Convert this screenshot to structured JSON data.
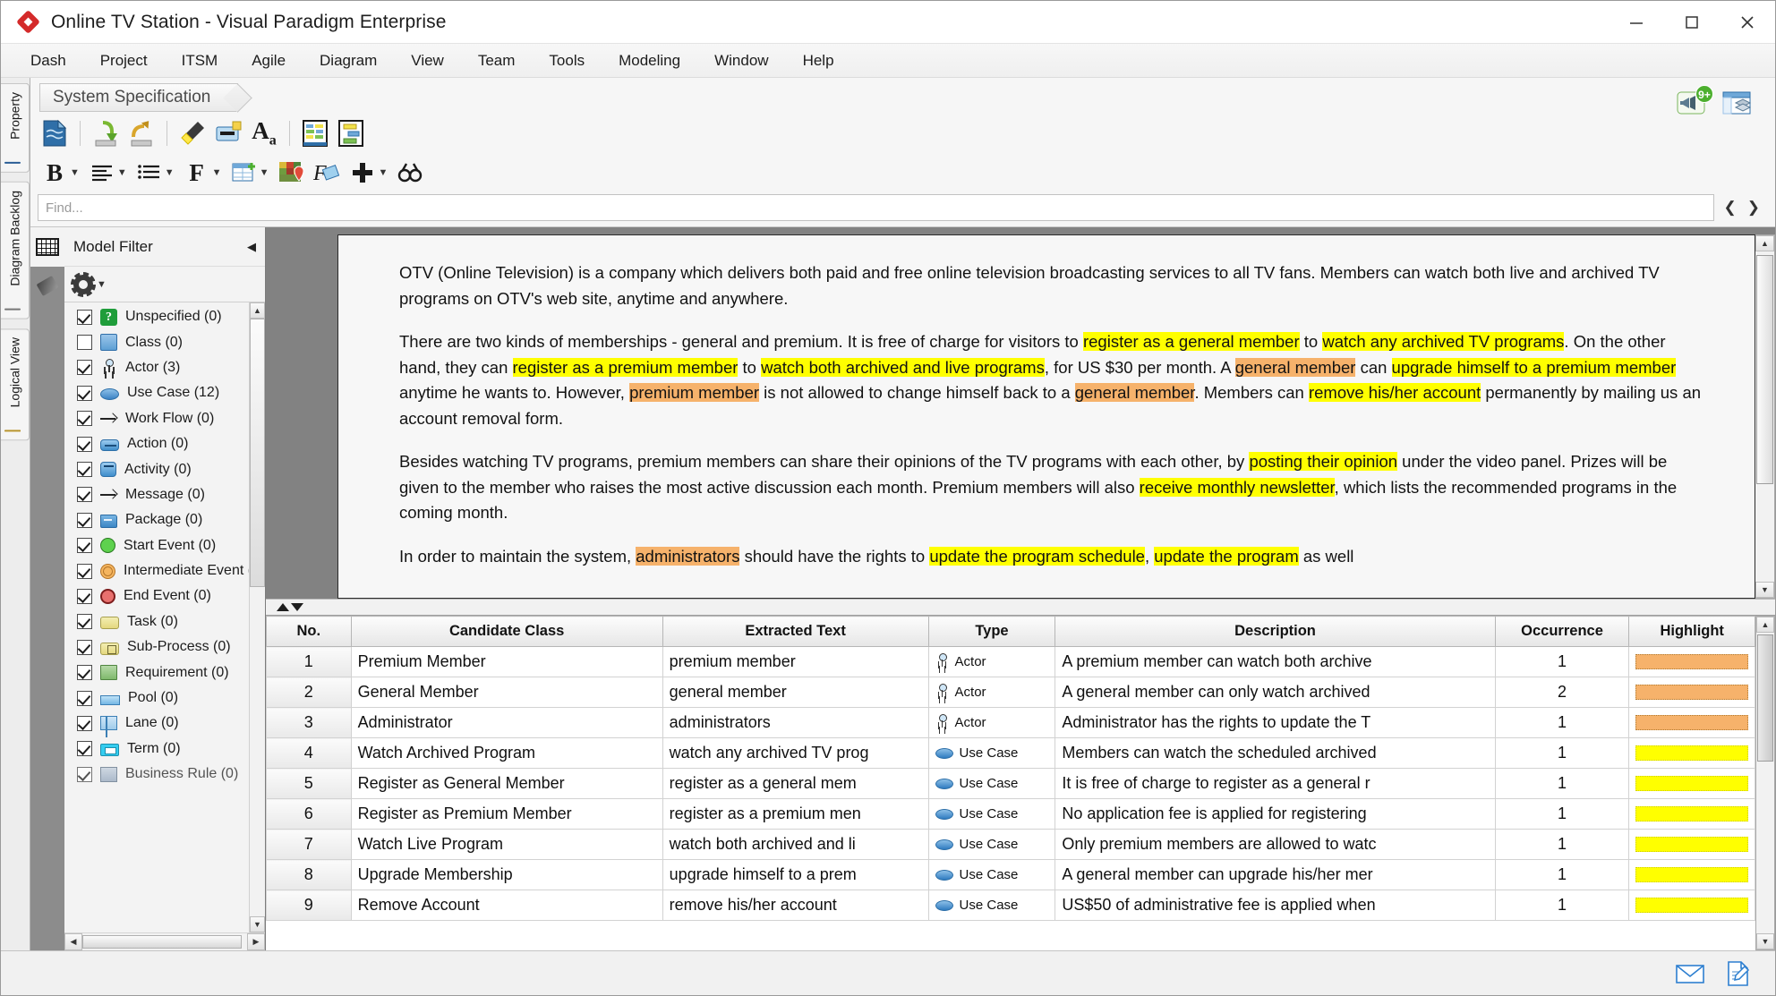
{
  "window": {
    "title": "Online TV Station - Visual Paradigm Enterprise",
    "logo_icon": "visual-paradigm-diamond-logo",
    "minimize_icon": "minimize-icon",
    "maximize_icon": "maximize-icon",
    "close_icon": "close-icon"
  },
  "menubar": {
    "items": [
      {
        "label": "Dash"
      },
      {
        "label": "Project"
      },
      {
        "label": "ITSM"
      },
      {
        "label": "Agile"
      },
      {
        "label": "Diagram"
      },
      {
        "label": "View"
      },
      {
        "label": "Team"
      },
      {
        "label": "Tools"
      },
      {
        "label": "Modeling"
      },
      {
        "label": "Window"
      },
      {
        "label": "Help"
      }
    ]
  },
  "breadcrumb": {
    "label": "System Specification"
  },
  "header_icons": {
    "notification": {
      "icon": "megaphone-icon",
      "badge": "9+"
    },
    "panel": {
      "icon": "open-panel-icon"
    }
  },
  "toolbar_primary": {
    "buttons": [
      {
        "icon": "document-properties-icon",
        "label": "Document Properties"
      },
      {
        "icon": "import-icon",
        "label": "Import"
      },
      {
        "icon": "export-icon",
        "label": "Export"
      },
      {
        "icon": "highlighter-icon",
        "label": "Highlighter"
      },
      {
        "icon": "annotate-icon",
        "label": "Annotate"
      },
      {
        "icon": "font-format-icon",
        "label": "Font"
      },
      {
        "icon": "candidate-class-view-icon",
        "label": "Candidate Classes"
      },
      {
        "icon": "diagram-view-icon",
        "label": "Diagram View"
      }
    ]
  },
  "toolbar_secondary": {
    "buttons": [
      {
        "icon": "bold-icon",
        "label": "B",
        "has_caret": true
      },
      {
        "icon": "align-icon",
        "label": "Align",
        "has_caret": true
      },
      {
        "icon": "list-icon",
        "label": "List",
        "has_caret": true
      },
      {
        "icon": "font-icon",
        "label": "F",
        "has_caret": true
      },
      {
        "icon": "insert-table-icon",
        "label": "Insert Table",
        "has_caret": true
      },
      {
        "icon": "color-picker-icon",
        "label": "Color"
      },
      {
        "icon": "format-shape-icon",
        "label": "Format Shape"
      },
      {
        "icon": "add-icon",
        "label": "Add",
        "has_caret": true
      },
      {
        "icon": "binoculars-find-icon",
        "label": "Find"
      }
    ]
  },
  "find": {
    "placeholder": "Find...",
    "value": "",
    "prev_icon": "chevron-left-icon",
    "next_icon": "chevron-right-icon"
  },
  "vertical_tabs": [
    {
      "label": "Property",
      "icon": "property-panel-icon"
    },
    {
      "label": "Diagram Backlog",
      "icon": "backlog-icon"
    },
    {
      "label": "Logical View",
      "icon": "folder-icon"
    }
  ],
  "model_filter": {
    "title": "Model Filter",
    "collapse_icon": "collapse-left-icon",
    "side_icons": [
      {
        "icon": "grid-table-icon",
        "selected": true
      },
      {
        "icon": "highlighter-pen-icon",
        "selected": false
      }
    ],
    "options_icon": "gear-icon",
    "options_caret": "caret-down-icon",
    "items": [
      {
        "label": "Unspecified (0)",
        "checked": true,
        "icon": "unspecified-icon"
      },
      {
        "label": "Class (0)",
        "checked": false,
        "icon": "class-icon"
      },
      {
        "label": "Actor (3)",
        "checked": true,
        "icon": "actor-icon"
      },
      {
        "label": "Use Case (12)",
        "checked": true,
        "icon": "usecase-icon"
      },
      {
        "label": "Work Flow (0)",
        "checked": true,
        "icon": "workflow-arrow-icon"
      },
      {
        "label": "Action (0)",
        "checked": true,
        "icon": "action-icon"
      },
      {
        "label": "Activity (0)",
        "checked": true,
        "icon": "activity-icon"
      },
      {
        "label": "Message (0)",
        "checked": true,
        "icon": "message-arrow-icon"
      },
      {
        "label": "Package (0)",
        "checked": true,
        "icon": "package-icon"
      },
      {
        "label": "Start Event (0)",
        "checked": true,
        "icon": "start-event-icon"
      },
      {
        "label": "Intermediate Event (0)",
        "checked": true,
        "icon": "intermediate-event-icon"
      },
      {
        "label": "End Event (0)",
        "checked": true,
        "icon": "end-event-icon"
      },
      {
        "label": "Task (0)",
        "checked": true,
        "icon": "task-icon"
      },
      {
        "label": "Sub-Process (0)",
        "checked": true,
        "icon": "subprocess-icon"
      },
      {
        "label": "Requirement (0)",
        "checked": true,
        "icon": "requirement-icon"
      },
      {
        "label": "Pool (0)",
        "checked": true,
        "icon": "pool-icon"
      },
      {
        "label": "Lane (0)",
        "checked": true,
        "icon": "lane-icon"
      },
      {
        "label": "Term (0)",
        "checked": true,
        "icon": "term-icon"
      },
      {
        "label": "Business Rule (0)",
        "checked": true,
        "icon": "business-rule-icon"
      }
    ]
  },
  "document": {
    "paragraphs": [
      [
        {
          "t": "OTV (Online Television) is a company which delivers both paid and free online television broadcasting services to all TV fans. Members can watch both live and archived TV programs on OTV's web site, anytime and anywhere.",
          "h": "none"
        }
      ],
      [
        {
          "t": "There are two kinds of memberships - general and premium. It is free of charge for visitors to ",
          "h": "none"
        },
        {
          "t": "register as a general member",
          "h": "yellow"
        },
        {
          "t": " to ",
          "h": "none"
        },
        {
          "t": "watch any archived TV programs",
          "h": "yellow"
        },
        {
          "t": ". On the other hand, they can ",
          "h": "none"
        },
        {
          "t": "register as a premium member",
          "h": "yellow"
        },
        {
          "t": " to ",
          "h": "none"
        },
        {
          "t": "watch both archived and live programs",
          "h": "yellow"
        },
        {
          "t": ", for US $30 per month. A ",
          "h": "none"
        },
        {
          "t": "general member",
          "h": "orange"
        },
        {
          "t": " can ",
          "h": "none"
        },
        {
          "t": "upgrade himself to a premium member",
          "h": "yellow"
        },
        {
          "t": " anytime he wants to. However, ",
          "h": "none"
        },
        {
          "t": "premium member",
          "h": "orange"
        },
        {
          "t": " is not allowed to change himself back to a ",
          "h": "none"
        },
        {
          "t": "general member",
          "h": "orange"
        },
        {
          "t": ". Members can ",
          "h": "none"
        },
        {
          "t": "remove his/her account",
          "h": "yellow"
        },
        {
          "t": " permanently by mailing us an account removal form.",
          "h": "none"
        }
      ],
      [
        {
          "t": "Besides watching TV programs, premium members can share their opinions of the TV programs with each other, by ",
          "h": "none"
        },
        {
          "t": "posting their opinion",
          "h": "yellow"
        },
        {
          "t": " under the video panel. Prizes will be given to the member who raises the most active discussion each month. Premium members will also ",
          "h": "none"
        },
        {
          "t": "receive monthly newsletter",
          "h": "yellow"
        },
        {
          "t": ", which lists the recommended programs in the coming month.",
          "h": "none"
        }
      ],
      [
        {
          "t": "In order to maintain the system, ",
          "h": "none"
        },
        {
          "t": "administrators",
          "h": "orange"
        },
        {
          "t": " should have the rights to ",
          "h": "none"
        },
        {
          "t": "update the program schedule",
          "h": "yellow"
        },
        {
          "t": ", ",
          "h": "none"
        },
        {
          "t": "update the program",
          "h": "yellow"
        },
        {
          "t": " as well",
          "h": "none"
        }
      ]
    ]
  },
  "splitter": {
    "up_icon": "splitter-up-icon",
    "down_icon": "splitter-down-icon"
  },
  "table": {
    "columns": [
      "No.",
      "Candidate Class",
      "Extracted Text",
      "Type",
      "Description",
      "Occurrence",
      "Highlight"
    ],
    "rows": [
      {
        "no": "1",
        "candidate_class": "Premium Member",
        "extracted_text": "premium member",
        "type": "Actor",
        "type_icon": "actor-icon",
        "description": "A premium member can watch both archive",
        "occurrence": "1",
        "highlight_color": "#f6b26b"
      },
      {
        "no": "2",
        "candidate_class": "General Member",
        "extracted_text": "general member",
        "type": "Actor",
        "type_icon": "actor-icon",
        "description": "A general member can only watch archived",
        "occurrence": "2",
        "highlight_color": "#f6b26b"
      },
      {
        "no": "3",
        "candidate_class": "Administrator",
        "extracted_text": "administrators",
        "type": "Actor",
        "type_icon": "actor-icon",
        "description": "Administrator has the rights to update the T",
        "occurrence": "1",
        "highlight_color": "#f6b26b"
      },
      {
        "no": "4",
        "candidate_class": "Watch Archived Program",
        "extracted_text": "watch any archived TV prog",
        "type": "Use Case",
        "type_icon": "usecase-icon",
        "description": "Members can watch the scheduled archived",
        "occurrence": "1",
        "highlight_color": "#ffff00"
      },
      {
        "no": "5",
        "candidate_class": "Register as General Member",
        "extracted_text": "register as a general mem",
        "type": "Use Case",
        "type_icon": "usecase-icon",
        "description": "It is free of charge to register as a general r",
        "occurrence": "1",
        "highlight_color": "#ffff00"
      },
      {
        "no": "6",
        "candidate_class": "Register as Premium Member",
        "extracted_text": "register as a premium men",
        "type": "Use Case",
        "type_icon": "usecase-icon",
        "description": "No application fee is applied for registering",
        "occurrence": "1",
        "highlight_color": "#ffff00"
      },
      {
        "no": "7",
        "candidate_class": "Watch Live Program",
        "extracted_text": "watch both archived and li",
        "type": "Use Case",
        "type_icon": "usecase-icon",
        "description": "Only premium members are allowed to watc",
        "occurrence": "1",
        "highlight_color": "#ffff00"
      },
      {
        "no": "8",
        "candidate_class": "Upgrade Membership",
        "extracted_text": "upgrade himself to a prem",
        "type": "Use Case",
        "type_icon": "usecase-icon",
        "description": "A general member can upgrade his/her mer",
        "occurrence": "1",
        "highlight_color": "#ffff00"
      },
      {
        "no": "9",
        "candidate_class": "Remove Account",
        "extracted_text": "remove his/her account",
        "type": "Use Case",
        "type_icon": "usecase-icon",
        "description": "US$50 of administrative fee is applied when",
        "occurrence": "1",
        "highlight_color": "#ffff00"
      }
    ]
  },
  "statusbar": {
    "icons": [
      {
        "icon": "mail-envelope-icon"
      },
      {
        "icon": "edit-document-icon"
      }
    ]
  }
}
